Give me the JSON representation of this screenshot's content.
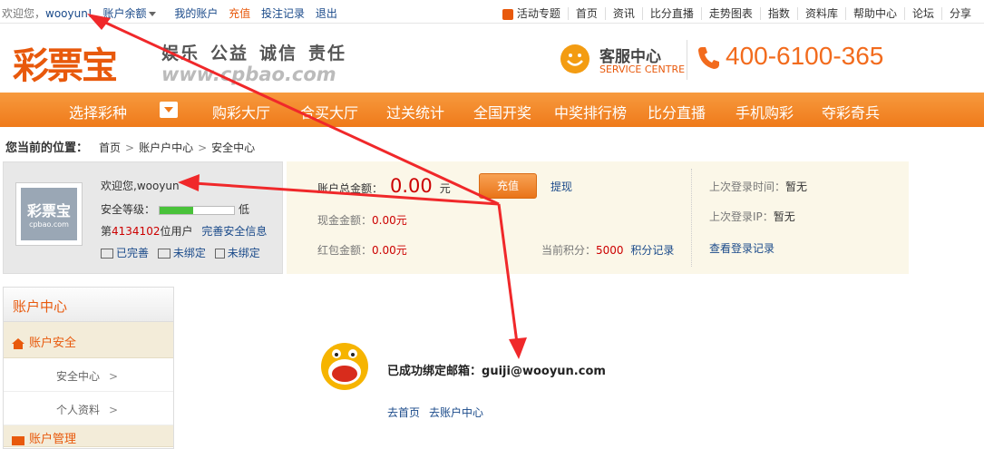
{
  "topbar": {
    "welcome": "欢迎您，",
    "username": "wooyun!",
    "balance_menu": "账户余额",
    "my_account": "我的账户",
    "recharge": "充值",
    "bet_records": "投注记录",
    "logout": "退出",
    "right_links": [
      "活动专题",
      "首页",
      "资讯",
      "比分直播",
      "走势图表",
      "指数",
      "资料库",
      "帮助中心",
      "论坛",
      "分享"
    ]
  },
  "header": {
    "logo": "彩票宝",
    "slogan": [
      "娱乐",
      "公益",
      "诚信",
      "责任"
    ],
    "domain": "www.cpbao.com",
    "service_title": "客服中心",
    "service_sub": "SERVICE CENTRE",
    "phone": "400-6100-365"
  },
  "nav": {
    "items": [
      "选择彩种",
      "购彩大厅",
      "合买大厅",
      "过关统计",
      "全国开奖",
      "中奖排行榜",
      "比分直播",
      "手机购彩",
      "夺彩奇兵"
    ]
  },
  "breadcrumb": {
    "label": "您当前的位置：",
    "items": [
      "首页",
      "账户户中心",
      "安全中心"
    ],
    "sep": ">"
  },
  "user": {
    "avatar_logo": "彩票宝",
    "avatar_sub": "cpbao.com",
    "welcome": "欢迎您,wooyun",
    "level_label": "安全等级：",
    "level_value": "低",
    "level_fraction": 0.45,
    "rank_prefix": "第",
    "rank_number": "4134102",
    "rank_suffix": "位用户",
    "complete_link": "完善安全信息",
    "status": [
      "已完善",
      "未绑定",
      "未绑定"
    ]
  },
  "account": {
    "total_label": "账户总金额：",
    "total_amount": "0.00",
    "total_unit": "元",
    "recharge_btn": "充值",
    "withdraw": "提现",
    "cash_label": "现金金额：",
    "cash_amount": "0.00",
    "cash_unit": "元",
    "bonus_label": "红包金额：",
    "bonus_amount": "0.00",
    "bonus_unit": "元",
    "points_label": "当前积分：",
    "points_value": "5000",
    "points_link": "积分记录",
    "last_time_label": "上次登录时间：",
    "last_time_value": "暂无",
    "last_ip_label": "上次登录IP：",
    "last_ip_value": "暂无",
    "login_records": "查看登录记录"
  },
  "sidebar": {
    "title": "账户中心",
    "section1": "账户安全",
    "sub_items": [
      "安全中心",
      "个人资料"
    ],
    "gt": ">",
    "section2": "账户管理"
  },
  "message": {
    "success_label": "已成功绑定邮箱：",
    "email": "guiji@wooyun.com",
    "link_home": "去首页",
    "link_account": "去账户中心"
  },
  "colors": {
    "accent": "#ef7a1a",
    "annotation": "#f0282a"
  }
}
